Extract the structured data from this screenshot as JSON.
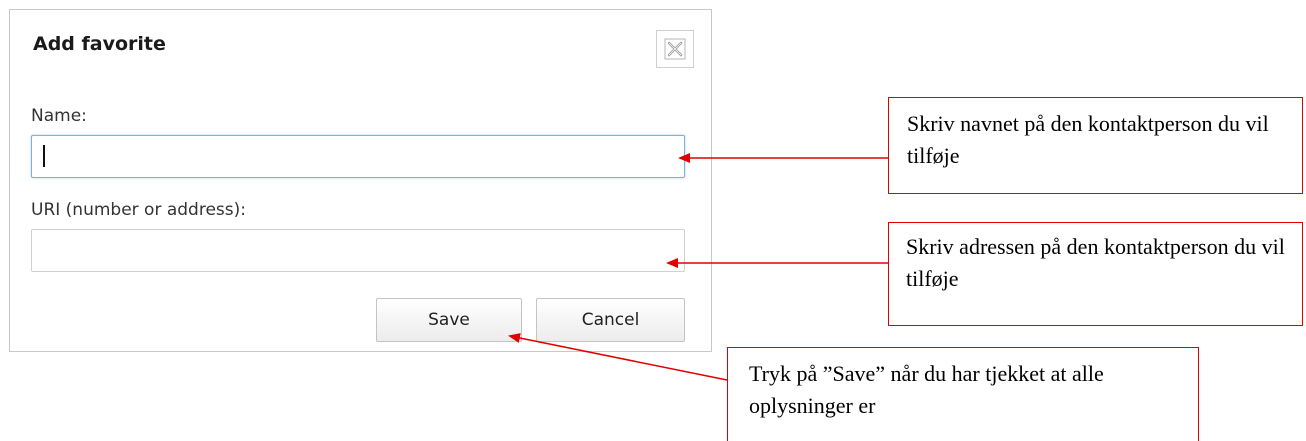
{
  "dialog": {
    "title": "Add favorite",
    "close_icon": "close-icon",
    "name_label": "Name:",
    "name_value": "",
    "uri_label": "URI (number or address):",
    "uri_value": "",
    "save_label": "Save",
    "cancel_label": "Cancel"
  },
  "annotations": {
    "name_note": "Skriv navnet på den kontaktperson du vil tilføje",
    "uri_note": "Skriv adressen på den kontaktperson du vil tilføje",
    "save_note": "Tryk på ”Save” når du har tjekket at alle oplysninger er",
    "accent_color": "#e00000"
  }
}
